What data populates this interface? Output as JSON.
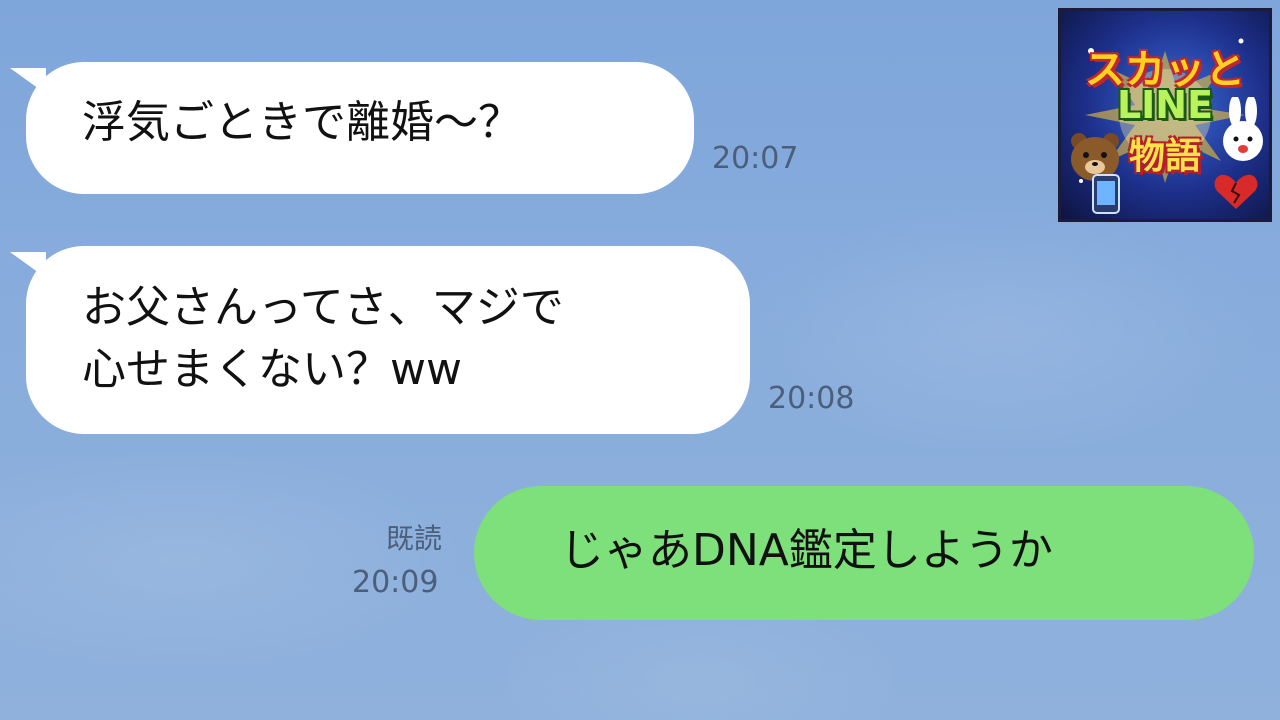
{
  "chat": {
    "messages": [
      {
        "side": "left",
        "lines": [
          "浮気ごときで離婚〜？"
        ],
        "time": "20:07"
      },
      {
        "side": "left",
        "lines": [
          "お父さんってさ、マジで",
          "心せまくない？ww"
        ],
        "time": "20:08"
      },
      {
        "side": "right",
        "lines": [
          "じゃあDNA鑑定しようか"
        ],
        "time": "20:09",
        "read_label": "既読"
      }
    ]
  },
  "logo": {
    "line1": "スカッと",
    "line2": "LINE",
    "line3": "物語"
  },
  "colors": {
    "background": "#86a9d9",
    "incoming_bubble": "#ffffff",
    "outgoing_bubble": "#7ee07a",
    "timestamp": "#4b5e7a"
  }
}
